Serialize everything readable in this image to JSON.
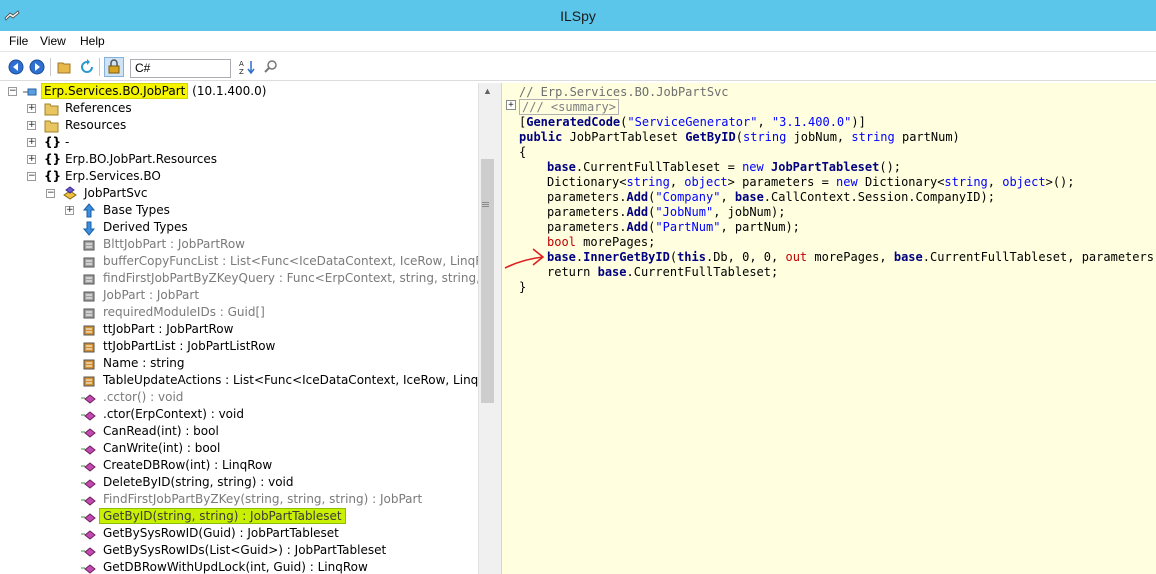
{
  "window": {
    "title": "ILSpy",
    "app_icon": "ilspy-icon"
  },
  "menu": {
    "file": "File",
    "view": "View",
    "help": "Help"
  },
  "toolbar": {
    "back_icon": "back-icon",
    "forward_icon": "forward-icon",
    "open_icon": "open-folder-icon",
    "reload_icon": "reload-icon",
    "show_internal_icon": "show-internal-icon",
    "language": "C#",
    "sort_icon": "sort-az-icon",
    "search_icon": "search-icon"
  },
  "tree": {
    "root": {
      "name": "Erp.Services.BO.JobPart",
      "version": " (10.1.400.0)"
    },
    "references": "References",
    "resources": "Resources",
    "ns_empty": "-",
    "ns_resources": "Erp.BO.JobPart.Resources",
    "ns_services": "Erp.Services.BO",
    "class_name": "JobPartSvc",
    "base_types": "Base Types",
    "derived_types": "Derived Types",
    "members": [
      {
        "label": "BlttJobPart : JobPartRow",
        "grey": true
      },
      {
        "label": "bufferCopyFuncList : List<Func<IceDataContext, IceRow, LinqRow>>",
        "grey": true
      },
      {
        "label": "findFirstJobPartByZKeyQuery : Func<ErpContext, string, string, string, Jo",
        "grey": true
      },
      {
        "label": "JobPart : JobPart",
        "grey": true
      },
      {
        "label": "requiredModuleIDs : Guid[]",
        "grey": true
      },
      {
        "label": "ttJobPart : JobPartRow",
        "grey": false
      },
      {
        "label": "ttJobPartList : JobPartListRow",
        "grey": false
      },
      {
        "label": "Name : string",
        "grey": false
      },
      {
        "label": "TableUpdateActions : List<Func<IceDataContext, IceRow, LinqRow>>",
        "grey": false
      },
      {
        "label": ".cctor() : void",
        "grey": true
      },
      {
        "label": ".ctor(ErpContext) : void",
        "grey": false
      },
      {
        "label": "CanRead(int) : bool",
        "grey": false
      },
      {
        "label": "CanWrite(int) : bool",
        "grey": false
      },
      {
        "label": "CreateDBRow(int) : LinqRow",
        "grey": false
      },
      {
        "label": "DeleteByID(string, string) : void",
        "grey": false
      },
      {
        "label": "FindFirstJobPartByZKey(string, string, string) : JobPart",
        "grey": true
      },
      {
        "label": "GetByID(string, string) : JobPartTableset",
        "grey": false,
        "highlight": true
      },
      {
        "label": "GetBySysRowID(Guid) : JobPartTableset",
        "grey": false
      },
      {
        "label": "GetBySysRowIDs(List<Guid>) : JobPartTableset",
        "grey": false
      },
      {
        "label": "GetDBRowWithUpdLock(int, Guid) : LinqRow",
        "grey": false
      }
    ]
  },
  "code": {
    "line1": "// Erp.Services.BO.JobPartSvc",
    "line2": "/// <summary>",
    "attr_open": "[",
    "attr_name": "GeneratedCode",
    "attr_args_open": "(",
    "attr_str1": "\"ServiceGenerator\"",
    "attr_sep": ", ",
    "attr_str2": "\"3.1.400.0\"",
    "attr_close": ")]",
    "sig_public": "public",
    "sig_type": " JobPartTableset ",
    "sig_name": "GetByID",
    "sig_p1": "(",
    "sig_string1": "string",
    "sig_p2": " jobNum, ",
    "sig_string2": "string",
    "sig_p3": " partNum)",
    "brace_open": "{",
    "l4_base": "base",
    "l4_rest": ".CurrentFullTableset = ",
    "l4_new": "new",
    "l4_type": " JobPartTableset",
    "l4_end": "();",
    "l5_a": "Dictionary<",
    "l5_string": "string",
    "l5_b": ", ",
    "l5_object": "object",
    "l5_c": "> parameters = ",
    "l5_new": "new",
    "l5_d": " Dictionary<",
    "l5_string2": "string",
    "l5_e": ", ",
    "l5_object2": "object",
    "l5_f": ">();",
    "l6_a": "parameters.",
    "l6_add": "Add",
    "l6_b": "(",
    "l6_str": "\"Company\"",
    "l6_c": ", ",
    "l6_base": "base",
    "l6_d": ".CallContext.Session.CompanyID);",
    "l7_a": "parameters.",
    "l7_add": "Add",
    "l7_b": "(",
    "l7_str": "\"JobNum\"",
    "l7_c": ", jobNum);",
    "l8_a": "parameters.",
    "l8_add": "Add",
    "l8_b": "(",
    "l8_str": "\"PartNum\"",
    "l8_c": ", partNum);",
    "l9_bool": "bool",
    "l9_rest": " morePages;",
    "l10_base": "base",
    "l10_dot": ".",
    "l10_method": "InnerGetByID",
    "l10_a": "(",
    "l10_this": "this",
    "l10_b": ".Db, 0, 0, ",
    "l10_out": "out",
    "l10_c": " morePages, ",
    "l10_base2": "base",
    "l10_d": ".CurrentFullTableset, parameters);",
    "l11_return": "return",
    "l11_sp": " ",
    "l11_base": "base",
    "l11_rest": ".CurrentFullTableset;",
    "brace_close": "}"
  },
  "colors": {
    "titlebar": "#5bc6ea",
    "code_background": "#ffffe0",
    "root_highlight": "#f5f500",
    "selected_highlight": "#c8f000",
    "annotation_arrow": "#e02020"
  }
}
